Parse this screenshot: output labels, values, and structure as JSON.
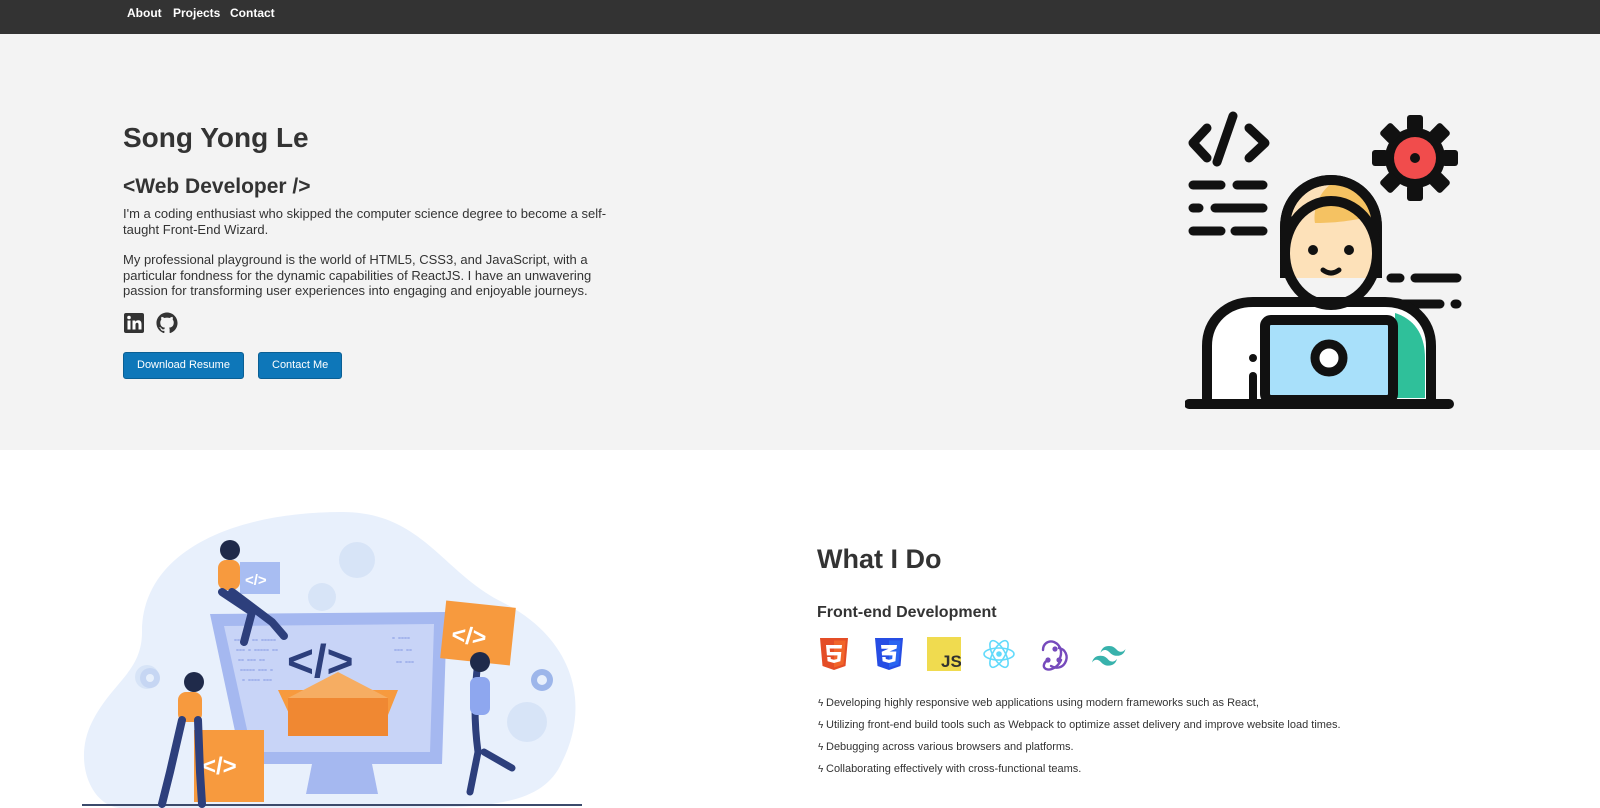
{
  "nav": {
    "items": [
      "About",
      "Projects",
      "Contact"
    ]
  },
  "hero": {
    "name": "Song Yong Le",
    "role": "<Web Developer />",
    "intro": "I'm a coding enthusiast who skipped the computer science degree to become a self-taught Front-End Wizard.",
    "bio": "My professional playground is the world of HTML5, CSS3, and JavaScript, with a particular fondness for the dynamic capabilities of ReactJS. I have an unwavering passion for transforming user experiences into engaging and enjoyable journeys.",
    "socials": [
      {
        "name": "linkedin",
        "icon": "linkedin-icon"
      },
      {
        "name": "github",
        "icon": "github-icon"
      }
    ],
    "buttons": {
      "resume": "Download Resume",
      "contact": "Contact Me"
    },
    "illustration_icon": "developer-illustration"
  },
  "what_i_do": {
    "title": "What I Do",
    "subtitle": "Front-end Development",
    "techs": [
      {
        "name": "html5",
        "icon": "html5-icon",
        "color": "#e44d26"
      },
      {
        "name": "css3",
        "icon": "css3-icon",
        "color": "#264de4"
      },
      {
        "name": "javascript",
        "icon": "javascript-icon",
        "color": "#f0db4f",
        "label": "JS"
      },
      {
        "name": "react",
        "icon": "react-icon",
        "color": "#61dafb"
      },
      {
        "name": "redux",
        "icon": "redux-icon",
        "color": "#764abc"
      },
      {
        "name": "tailwind",
        "icon": "tailwind-icon",
        "color": "#38b2ac"
      }
    ],
    "bolt_symbol": "ϟ",
    "points": [
      "Developing highly responsive web applications using modern frameworks such as React,",
      "Utilizing front-end build tools such as Webpack to optimize asset delivery and improve website load times.",
      "Debugging across various browsers and platforms.",
      "Collaborating effectively with cross-functional teams."
    ]
  },
  "colors": {
    "navbar": "#333333",
    "hero_bg": "#f3f3f3",
    "button": "#0e77b9",
    "text": "#333333"
  },
  "illustration_code_symbol": "</>"
}
